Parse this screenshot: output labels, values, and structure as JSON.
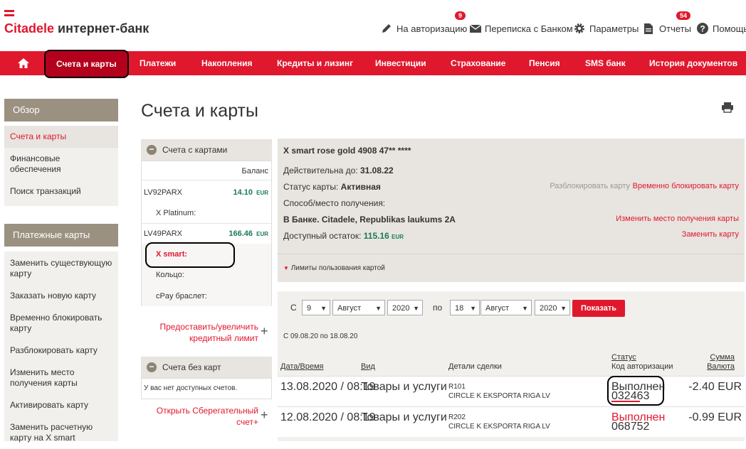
{
  "header": {
    "logo_brand": "Citadele",
    "logo_rest": "интернет-банк",
    "links": [
      {
        "label": "На авторизацию",
        "icon": "pencil-icon",
        "badge": "9"
      },
      {
        "label": "Переписка с Банком",
        "icon": "envelope-icon"
      },
      {
        "label": "Параметры",
        "icon": "gear-icon"
      },
      {
        "label": "Отчеты",
        "icon": "document-icon",
        "badge": "54"
      },
      {
        "label": "Помощь",
        "icon": "help-icon"
      }
    ]
  },
  "nav": {
    "home_icon": "home-icon",
    "items": [
      "Счета и карты",
      "Платежи",
      "Накопления",
      "Кредиты и лизинг",
      "Инвестиции",
      "Страхование",
      "Пенсия",
      "SMS банк",
      "История документов"
    ]
  },
  "sidebar": {
    "overview_title": "Обзор",
    "overview_items": [
      "Счета и карты",
      "Финансовые обеспечения",
      "Поиск транзакций"
    ],
    "cards_title": "Платежные карты",
    "cards_items": [
      "Заменить существующую карту",
      "Заказать новую карту",
      "Временно блокировать карту",
      "Разблокировать карту",
      "Изменить место получения карты",
      "Активировать карту",
      "Заменить расчетную карту на X smart"
    ]
  },
  "page": {
    "title": "Счета и карты"
  },
  "accounts": {
    "with_cards_title": "Счета с картами",
    "balance_header": "Баланс",
    "rows": [
      {
        "account": "LV92PARX",
        "amount": "14.10",
        "currency": "EUR",
        "card": "X Platinum:"
      },
      {
        "account": "LV49PARX",
        "amount": "166.46",
        "currency": "EUR",
        "cards": [
          "X smart:",
          "Кольцо:",
          "cPay браслет:"
        ]
      }
    ],
    "credit_link": "Предоставить/увеличить кредитный лимит",
    "without_cards_title": "Счета без карт",
    "no_accounts": "У вас нет доступных счетов.",
    "savings_link": "Открыть Сберегательный счет+"
  },
  "card_details": {
    "title": "X smart rose gold 4908 47** ****",
    "valid_label": "Действительна до:",
    "valid_value": "31.08.22",
    "status_label": "Статус карты:",
    "status_value": "Активная",
    "pickup_label": "Способ/место получения:",
    "pickup_value": "В Банке.  Citadele, Republikas laukums 2A",
    "balance_label": "Доступный остаток:",
    "balance_value": "115.16",
    "balance_currency": "EUR",
    "unblock": "Разблокировать карту",
    "temp_block": "Временно блокировать карту",
    "change_place": "Изменить место получения карты",
    "replace": "Заменить карту",
    "limits": "Лимиты пользования картой"
  },
  "filter": {
    "from_label": "С",
    "to_label": "по",
    "from_day": "9",
    "from_month": "Август",
    "from_year": "2020",
    "to_day": "18",
    "to_month": "Август",
    "to_year": "2020",
    "show_button": "Показать",
    "range_text": "С 09.08.20  по 18.08.20"
  },
  "table": {
    "headers": {
      "date": "Дата/Время",
      "type": "Вид",
      "details": "Детали сделки",
      "status": "Статус",
      "auth_code": "Код авторизации",
      "amount": "Сумма",
      "currency": "Валюта"
    },
    "rows": [
      {
        "date": "13.08.2020 / 08:19",
        "type": "Товары и услуги",
        "ref": "R101",
        "merchant": "CIRCLE K EKSPORTA RIGA LV",
        "status": "Выполнен",
        "code": "032463",
        "amount": "-2.40 EUR"
      },
      {
        "date": "12.08.2020 / 08:19",
        "type": "Товары и услуги",
        "ref": "R202",
        "merchant": "CIRCLE K EKSPORTA RIGA LV",
        "status": "Выполнен",
        "code": "068752",
        "amount": "-0.99 EUR"
      }
    ]
  },
  "colors": {
    "brand": "#e0182d",
    "sidebar_head": "#9b9181",
    "panel_bg": "#e8e4df",
    "amount_green": "#1a7a55"
  }
}
